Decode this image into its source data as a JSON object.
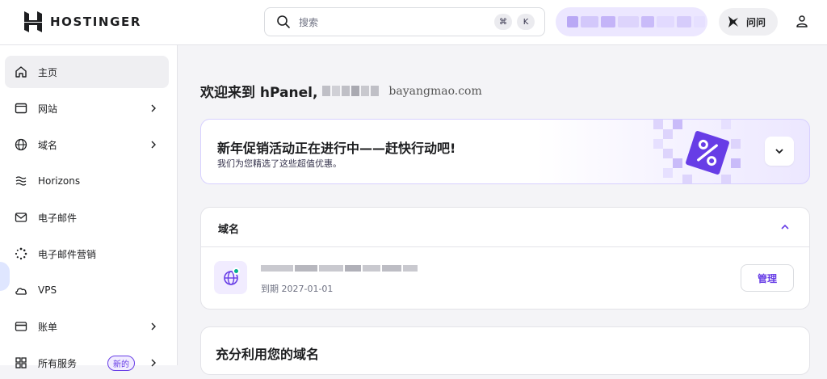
{
  "header": {
    "brand": "HOSTINGER",
    "search_placeholder": "搜索",
    "shortcut_keys": [
      "⌘",
      "K"
    ],
    "ask_label": "问问"
  },
  "sidebar": {
    "items": [
      {
        "label": "主页",
        "icon": "home-icon",
        "active": true,
        "has_chevron": false
      },
      {
        "label": "网站",
        "icon": "browser-window-icon",
        "active": false,
        "has_chevron": true
      },
      {
        "label": "域名",
        "icon": "globe-icon",
        "active": false,
        "has_chevron": true
      },
      {
        "label": "Horizons",
        "icon": "horizons-waves-icon",
        "active": false,
        "has_chevron": false
      },
      {
        "label": "电子邮件",
        "icon": "envelope-icon",
        "active": false,
        "has_chevron": false
      },
      {
        "label": "电子邮件营销",
        "icon": "loader-dots-icon",
        "active": false,
        "has_chevron": false
      },
      {
        "label": "VPS",
        "icon": "cloud-icon",
        "active": false,
        "has_chevron": false
      },
      {
        "label": "账单",
        "icon": "credit-card-icon",
        "active": false,
        "has_chevron": true
      },
      {
        "label": "所有服务",
        "icon": "grid-icon",
        "active": false,
        "has_chevron": true,
        "badge": "新的"
      }
    ]
  },
  "main": {
    "welcome_text": "欢迎来到 hPanel,",
    "welcome_domain": "bayangmao.com",
    "promo": {
      "title": "新年促销活动正在进行中——赶快行动吧!",
      "subtitle": "我们为您精选了这些超值优惠。"
    },
    "domains_card": {
      "title": "域名",
      "expiry": "到期 2027-01-01",
      "manage_label": "管理"
    },
    "use_card": {
      "title": "充分利用您的域名"
    }
  },
  "colors": {
    "accent": "#673de6",
    "accent_light": "#ece7ff",
    "status_active": "#00b090"
  }
}
